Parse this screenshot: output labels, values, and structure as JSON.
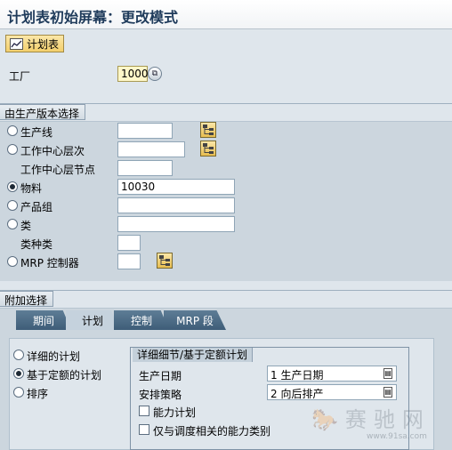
{
  "title": "计划表初始屏幕：更改模式",
  "toolbar": {
    "plan_button_label": "计划表"
  },
  "plant": {
    "label": "工厂",
    "value": "1000"
  },
  "section_version": {
    "title": "由生产版本选择",
    "rows": [
      {
        "label": "生产线",
        "value": "",
        "selected": false
      },
      {
        "label": "工作中心层次",
        "value": "",
        "selected": false
      },
      {
        "label": "工作中心层节点",
        "value": ""
      },
      {
        "label": "物料",
        "value": "10030",
        "selected": true
      },
      {
        "label": "产品组",
        "value": "",
        "selected": false
      },
      {
        "label": "类",
        "value": "",
        "selected": false
      },
      {
        "label": "类种类",
        "value": ""
      },
      {
        "label": "MRP 控制器",
        "value": "",
        "selected": false
      }
    ]
  },
  "section_additional": {
    "title": "附加选择",
    "tabs": [
      "期间",
      "计划",
      "控制",
      "MRP 段"
    ],
    "active_tab": "计划",
    "options": [
      {
        "label": "详细的计划",
        "selected": false
      },
      {
        "label": "基于定额的计划",
        "selected": true
      },
      {
        "label": "排序",
        "selected": false
      }
    ],
    "group_title": "详细细节/基于定额计划",
    "production_date": {
      "label": "生产日期",
      "value": "1 生产日期"
    },
    "scheduling": {
      "label": "安排策略",
      "value": "2 向后排产"
    },
    "checkboxes": [
      {
        "label": "能力计划",
        "checked": false
      },
      {
        "label": "仅与调度相关的能力类别",
        "checked": false
      }
    ]
  },
  "watermark": {
    "text": "赛驰网",
    "url": "www.91sa.com"
  },
  "colors": {
    "title": "#1f3b5b",
    "tab_active": "#c5d2dd",
    "tab_inactive": "#4e6d88"
  }
}
